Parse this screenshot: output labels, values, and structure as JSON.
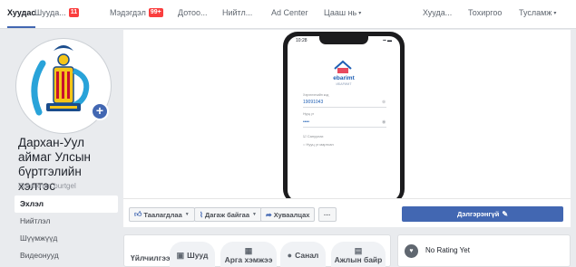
{
  "topnav": {
    "tabs": [
      {
        "label": "Хуудас",
        "badge": ""
      },
      {
        "label": "Шууда...",
        "badge": "11"
      },
      {
        "label": "Мэдэгдэл",
        "badge": "99+"
      },
      {
        "label": "Дотоо...",
        "badge": ""
      },
      {
        "label": "Нийтл...",
        "badge": ""
      },
      {
        "label": "Ad Center",
        "badge": ""
      },
      {
        "label": "Цааш нь",
        "badge": ""
      },
      {
        "label": "Хууда...",
        "badge": ""
      },
      {
        "label": "Тохиргоо",
        "badge": ""
      },
      {
        "label": "Тусламж",
        "badge": ""
      }
    ]
  },
  "page": {
    "name": "Дархан-Уул аймаг Улсын бүртгэлийн хэлтэс",
    "handle": "@darkhan.burtgel"
  },
  "sidebar": {
    "items": [
      {
        "label": "Эхлэл"
      },
      {
        "label": "Нийтлэл"
      },
      {
        "label": "Шүүмжүүд"
      },
      {
        "label": "Видеонууд"
      }
    ]
  },
  "cover": {
    "status_time": "10:28",
    "app_name": "ebarimt",
    "app_sub": "ИБАРИМТ",
    "fields": [
      {
        "label": "Хэрэглэгчийн код",
        "value": "19091043"
      },
      {
        "label": "Нууц үг",
        "value": "••••"
      }
    ],
    "checkbox_1": "Сануулах",
    "checkbox_2": "Нууц үг мартсан"
  },
  "actions": {
    "like": "Таалагдлаа",
    "follow": "Дагаж байгаа",
    "share": "Хуваалцах",
    "more": "···",
    "cta": "Дэлгэрэнгүй"
  },
  "tabs_row": {
    "label": "Үйлчилгээ",
    "tabs": [
      {
        "label": "Шууд",
        "icon": "live-video-icon"
      },
      {
        "label": "Арга хэмжээ",
        "icon": "calendar-icon"
      },
      {
        "label": "Санал",
        "icon": "offer-icon"
      },
      {
        "label": "Ажлын байр",
        "icon": "briefcase-icon"
      }
    ]
  },
  "rating": {
    "text": "No Rating Yet"
  },
  "colors": {
    "accent": "#4267b2",
    "badge": "#fa3e3e",
    "background": "#e9ebee"
  }
}
